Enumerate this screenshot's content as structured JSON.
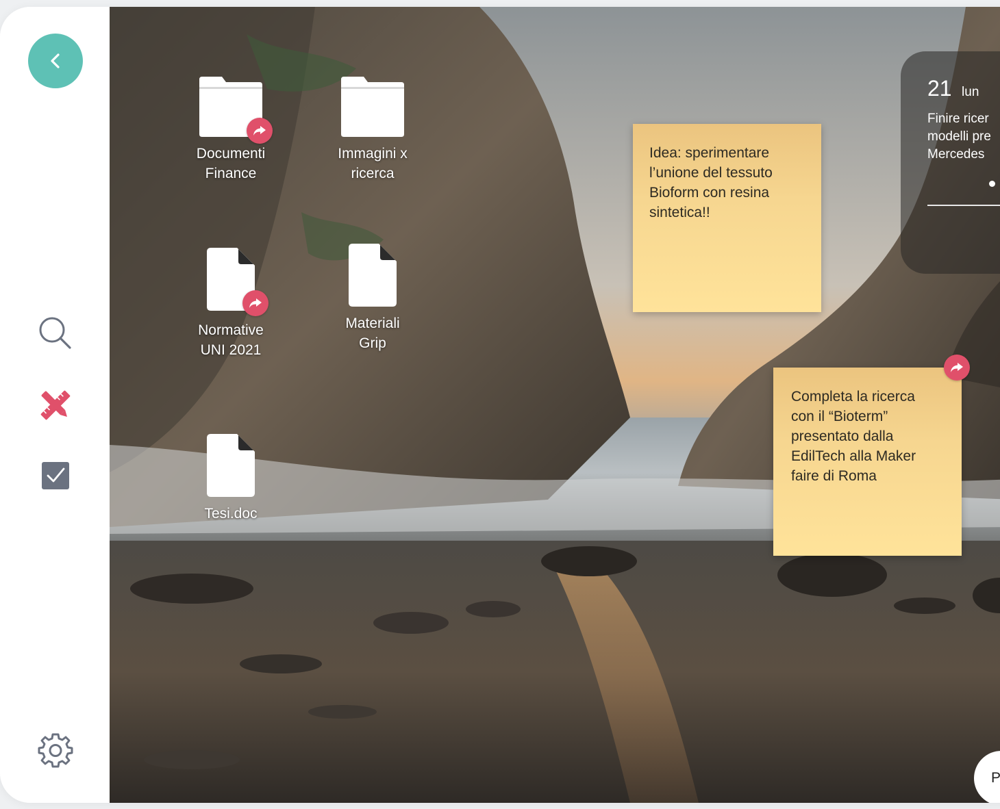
{
  "sidebar": {
    "back_icon": "chevron-left-icon",
    "items": [
      {
        "name": "search",
        "icon": "search-icon"
      },
      {
        "name": "tools",
        "icon": "pencil-ruler-icon"
      },
      {
        "name": "tasks",
        "icon": "checkbox-icon"
      },
      {
        "name": "settings",
        "icon": "gear-icon"
      }
    ],
    "accent_color": "#5ec1b5",
    "tools_color": "#e0506a"
  },
  "desktop": {
    "icons": [
      {
        "label_line1": "Documenti",
        "label_line2": "Finance",
        "type": "folder",
        "shared": true
      },
      {
        "label_line1": "Immagini x",
        "label_line2": "ricerca",
        "type": "folder",
        "shared": false
      },
      {
        "label_line1": "Normative",
        "label_line2": "UNI 2021",
        "type": "file",
        "shared": true
      },
      {
        "label_line1": "Materiali",
        "label_line2": "Grip",
        "type": "file",
        "shared": false
      },
      {
        "label_line1": "Tesi.doc",
        "type": "file",
        "shared": false
      }
    ],
    "notes": [
      {
        "line1": "Idea: sperimentare",
        "line2": "l’unione del tessuto",
        "line3": "Bioform con resina",
        "line4": "sintetica!!",
        "shared": false
      },
      {
        "line1": "Completa la ricerca",
        "line2": "con il “Bioterm”",
        "line3": "presentato dalla",
        "line4": "EdilTech alla Maker",
        "line5": "faire di Roma",
        "shared": true
      }
    ],
    "calendar": {
      "day": "21",
      "weekday": "lun",
      "line1": "Finire ricer",
      "line2": "modelli pre",
      "line3": "Mercedes"
    },
    "bottom_pill_label": "P"
  },
  "colors": {
    "share_badge": "#e0506a",
    "note": "#ffe39a"
  }
}
